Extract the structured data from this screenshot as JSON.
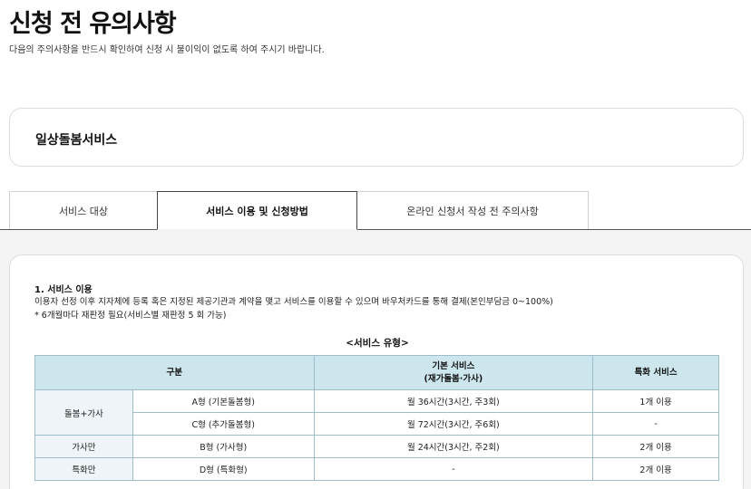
{
  "header": {
    "title": "신청 전 유의사항",
    "subtitle": "다음의 주의사항을 반드시 확인하여 신청 시 불이익이 없도록 하여 주시기 바랍니다."
  },
  "service": {
    "name": "일상돌봄서비스"
  },
  "tabs": [
    {
      "label": "서비스 대상",
      "active": false
    },
    {
      "label": "서비스 이용 및 신청방법",
      "active": true
    },
    {
      "label": "온라인 신청서 작성 전 주의사항",
      "active": false
    }
  ],
  "section": {
    "heading": "1. 서비스 이용",
    "line1": "이용자 선정 이후 지자체에 등록 혹은 지정된 제공기관과 계약을 맺고 서비스를 이용할 수 있으며 바우처카드를 통해 결제(본인부담금 0~100%)",
    "line2": "* 6개월마다 재판정 필요(서비스별 재판정 5 회 가능)"
  },
  "table": {
    "caption": "<서비스 유형>",
    "headers": {
      "category": "구분",
      "basic_line1": "기본 서비스",
      "basic_line2": "(재가돌봄·가사)",
      "special": "특화 서비스"
    },
    "groups": {
      "care_housework": "돌봄+가사",
      "housework_only": "가사만",
      "special_only": "특화만"
    },
    "rows": [
      {
        "type": "A형 (기본돌봄형)",
        "basic": "월 36시간(3시간, 주3회)",
        "special": "1개 이용"
      },
      {
        "type": "C형 (추가돌봄형)",
        "basic": "월 72시간(3시간, 주6회)",
        "special": "-"
      },
      {
        "type": "B형 (가사형)",
        "basic": "월 24시간(3시간, 주2회)",
        "special": "2개 이용"
      },
      {
        "type": "D형 (특화형)",
        "basic": "-",
        "special": "2개 이용"
      }
    ]
  }
}
